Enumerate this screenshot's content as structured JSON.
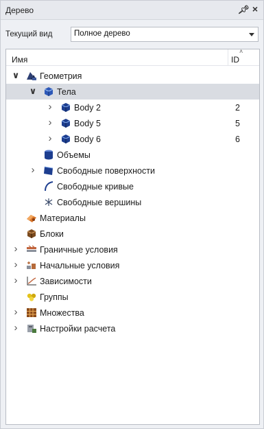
{
  "panel": {
    "title": "Дерево",
    "pin_glyph": "ɐ",
    "close_glyph": "×"
  },
  "view": {
    "label": "Текущий вид",
    "selected": "Полное дерево"
  },
  "tree": {
    "columns": {
      "name": "Имя",
      "id": "ID"
    },
    "rows": [
      {
        "label": "Геометрия",
        "id": "",
        "expander": "expanded",
        "icon": "geometry-icon"
      },
      {
        "label": "Тела",
        "id": "",
        "expander": "expanded",
        "icon": "bodies-icon",
        "selected": true
      },
      {
        "label": "Body 2",
        "id": "2",
        "expander": "collapsed",
        "icon": "body-icon"
      },
      {
        "label": "Body 5",
        "id": "5",
        "expander": "collapsed",
        "icon": "body-icon"
      },
      {
        "label": "Body 6",
        "id": "6",
        "expander": "collapsed",
        "icon": "body-icon"
      },
      {
        "label": "Объемы",
        "id": "",
        "expander": "none",
        "icon": "volumes-icon"
      },
      {
        "label": "Свободные поверхности",
        "id": "",
        "expander": "collapsed",
        "icon": "free-surfaces-icon"
      },
      {
        "label": "Свободные кривые",
        "id": "",
        "expander": "none",
        "icon": "free-curves-icon"
      },
      {
        "label": "Свободные вершины",
        "id": "",
        "expander": "none",
        "icon": "free-vertices-icon"
      },
      {
        "label": "Материалы",
        "id": "",
        "expander": "none",
        "icon": "materials-icon"
      },
      {
        "label": "Блоки",
        "id": "",
        "expander": "none",
        "icon": "blocks-icon"
      },
      {
        "label": "Граничные условия",
        "id": "",
        "expander": "collapsed",
        "icon": "boundary-conditions-icon"
      },
      {
        "label": "Начальные условия",
        "id": "",
        "expander": "collapsed",
        "icon": "initial-conditions-icon"
      },
      {
        "label": "Зависимости",
        "id": "",
        "expander": "collapsed",
        "icon": "dependencies-icon"
      },
      {
        "label": "Группы",
        "id": "",
        "expander": "none",
        "icon": "groups-icon"
      },
      {
        "label": "Множества",
        "id": "",
        "expander": "collapsed",
        "icon": "sets-icon"
      },
      {
        "label": "Настройки расчета",
        "id": "",
        "expander": "collapsed",
        "icon": "calc-settings-icon"
      }
    ]
  },
  "colors": {
    "selection": "#d9dce2",
    "panel_bg": "#eef0f4",
    "tree_bg": "#ffffff"
  }
}
